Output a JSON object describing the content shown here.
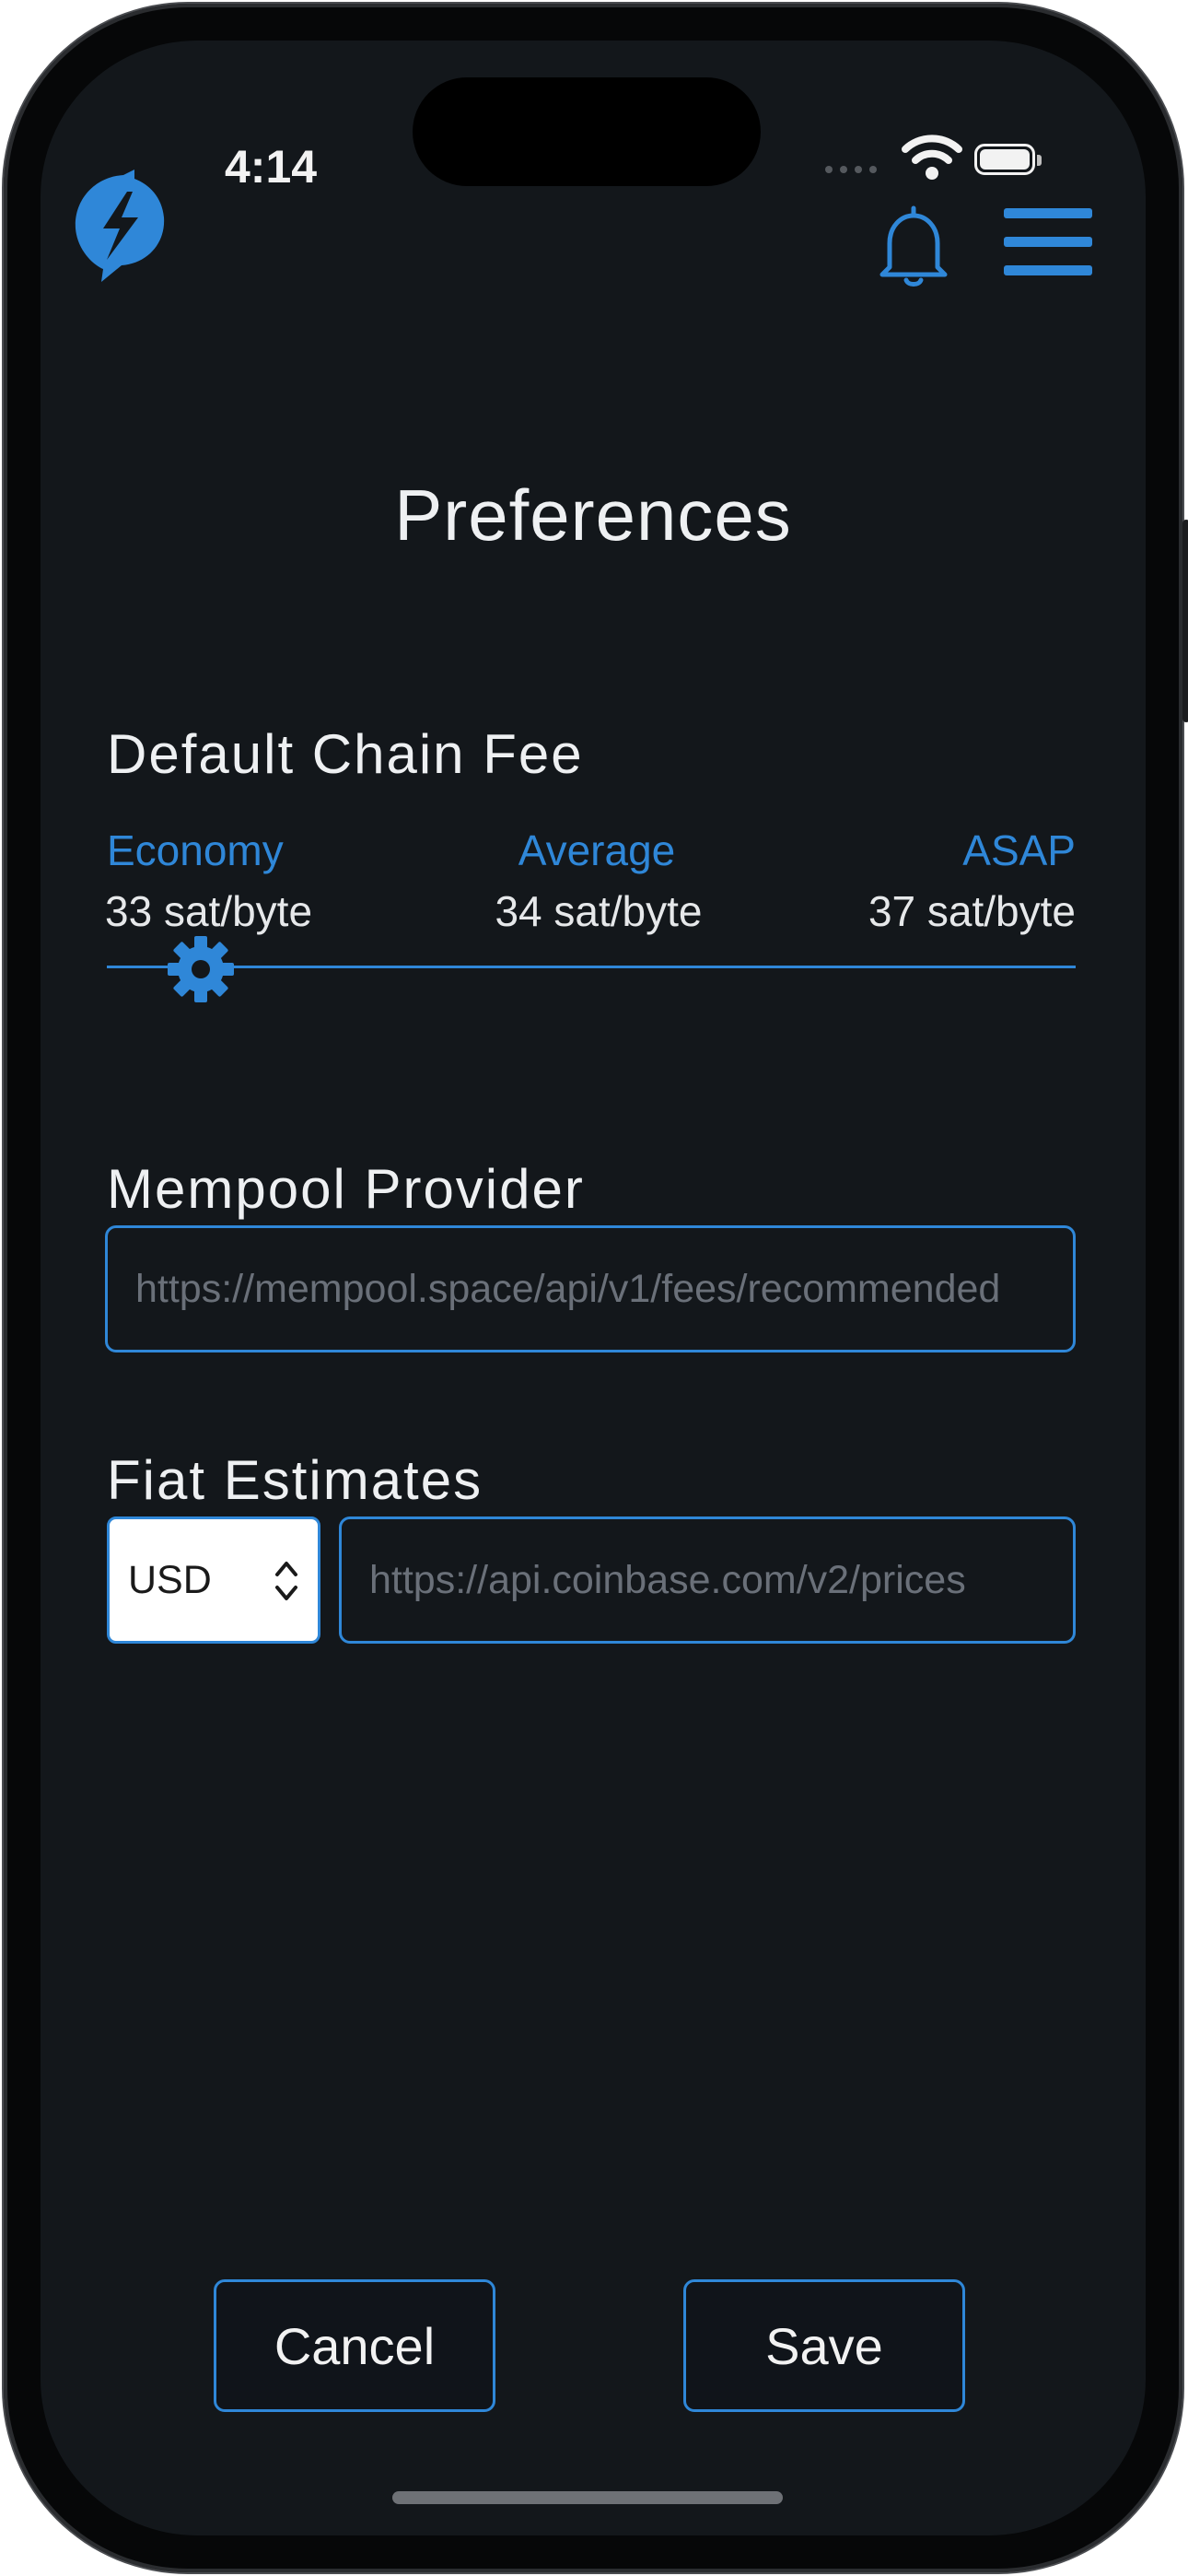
{
  "status_bar": {
    "time": "4:14"
  },
  "header": {
    "logo_icon": "lightning-bolt-logo-icon",
    "bell_icon": "bell-icon",
    "menu_icon": "hamburger-menu-icon"
  },
  "page": {
    "title": "Preferences"
  },
  "chain_fee": {
    "title": "Default Chain Fee",
    "options": [
      {
        "label": "Economy",
        "value": "33 sat/byte"
      },
      {
        "label": "Average",
        "value": "34 sat/byte"
      },
      {
        "label": "ASAP",
        "value": "37 sat/byte"
      }
    ],
    "slider_icon": "gear-icon",
    "slider_selected": "Economy"
  },
  "mempool": {
    "title": "Mempool Provider",
    "url": "https://mempool.space/api/v1/fees/recommended"
  },
  "fiat": {
    "title": "Fiat Estimates",
    "currency": "USD",
    "url": "https://api.coinbase.com/v2/prices"
  },
  "actions": {
    "cancel": "Cancel",
    "save": "Save"
  },
  "colors": {
    "accent": "#2f87d8",
    "background": "#13171b",
    "text": "#eef0f2"
  }
}
